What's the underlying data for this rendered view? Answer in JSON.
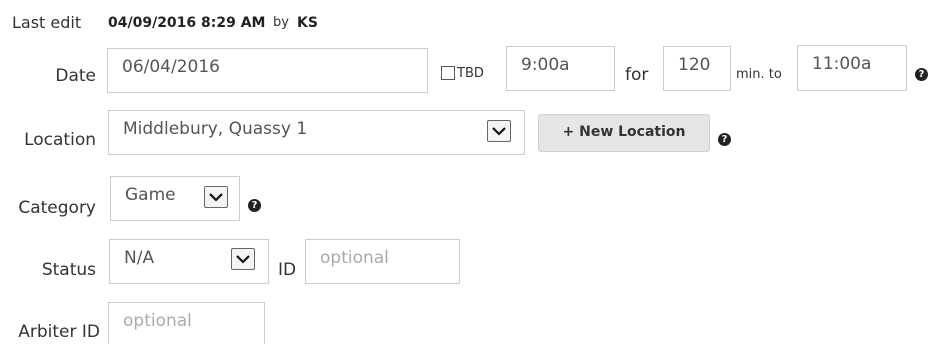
{
  "last_edit": {
    "label": "Last edit",
    "datetime": "04/09/2016 8:29 AM",
    "by": "by",
    "user": "KS"
  },
  "date_row": {
    "label": "Date",
    "date_value": "06/04/2016",
    "tbd_label": "TBD",
    "tbd_checked": false,
    "start_time": "9:00a",
    "for_label": "for",
    "duration": "120",
    "min_to_label": "min. to",
    "end_time": "11:00a",
    "help": "?"
  },
  "location_row": {
    "label": "Location",
    "value": "Middlebury, Quassy 1",
    "new_location_button": "+ New Location",
    "help": "?"
  },
  "category_row": {
    "label": "Category",
    "value": "Game",
    "help": "?"
  },
  "status_row": {
    "label": "Status",
    "value": "N/A",
    "id_label": "ID",
    "id_placeholder": "optional"
  },
  "arbiter_row": {
    "label": "Arbiter ID",
    "placeholder": "optional"
  }
}
